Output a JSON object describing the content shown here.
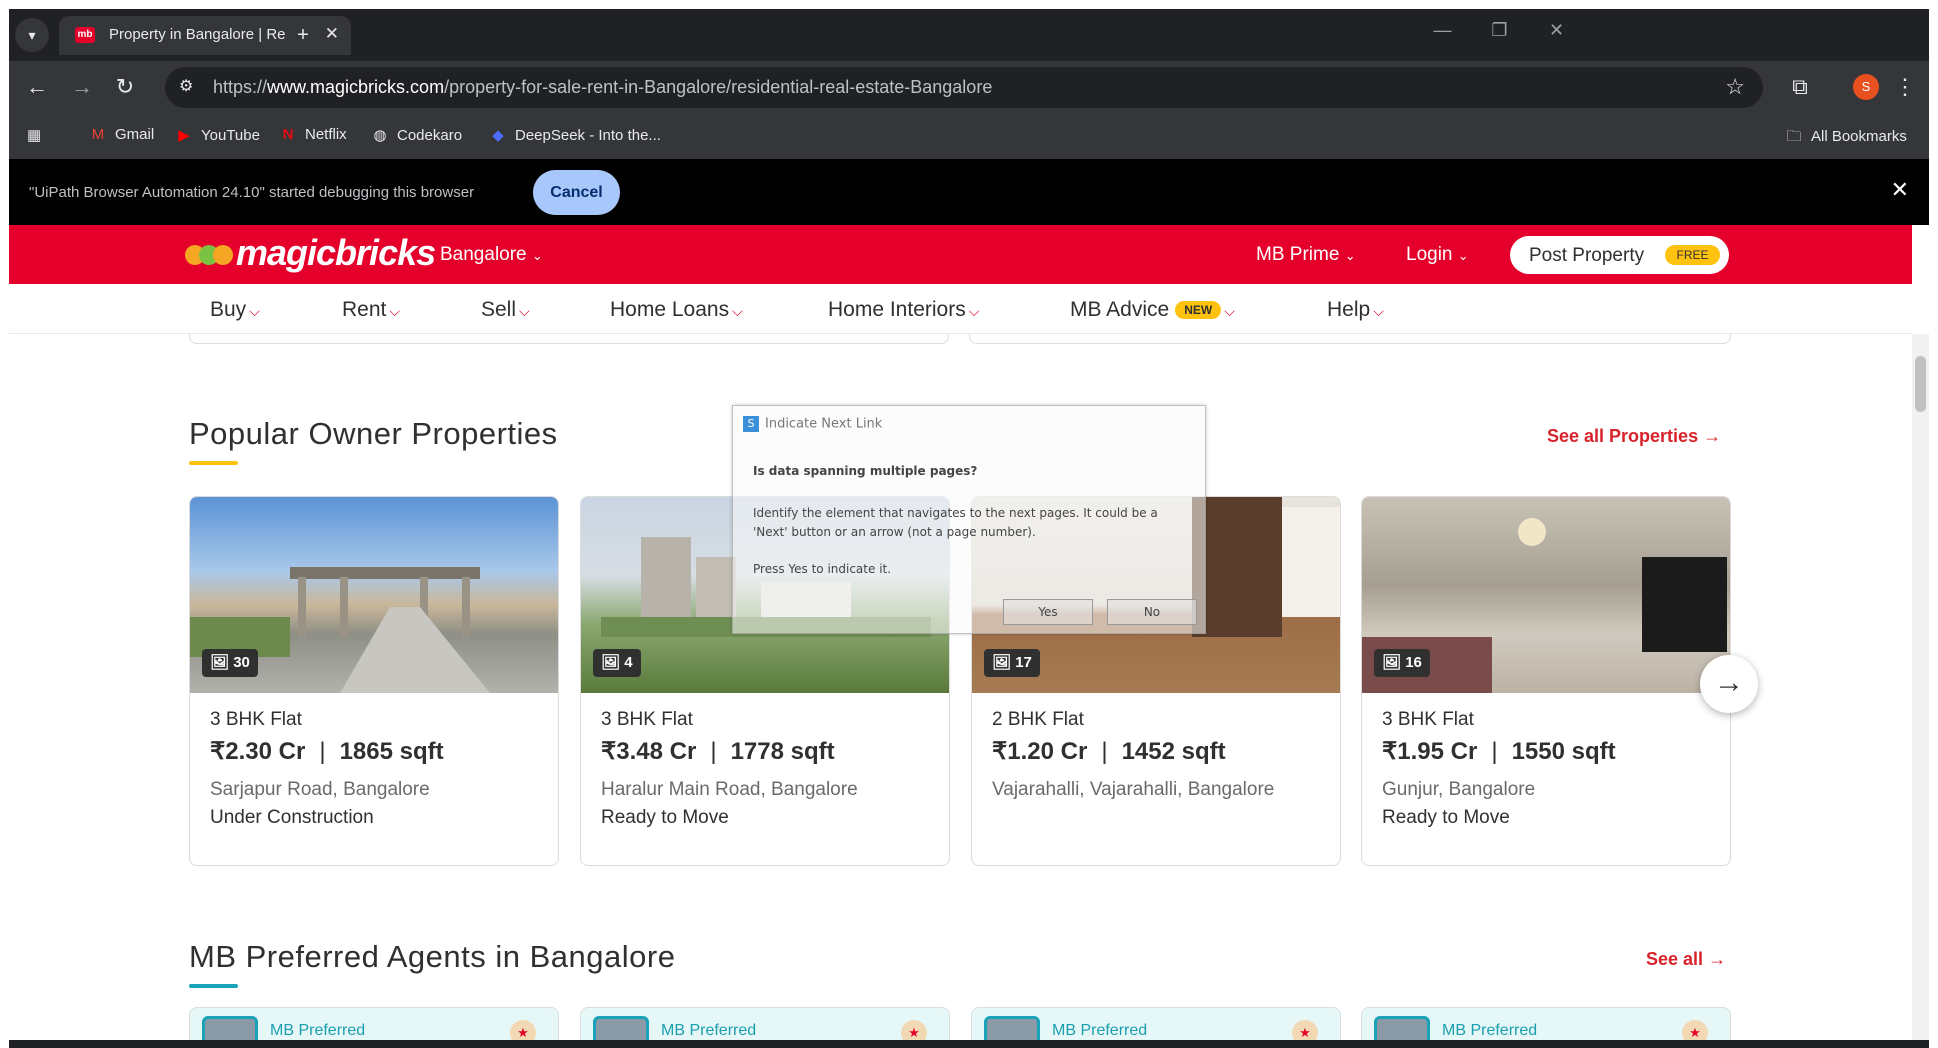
{
  "browser": {
    "tab_title": "Property in Bangalore | Real Est",
    "tab_favicon": "mb",
    "url_prefix": "https://",
    "url_domain": "www.magicbricks.com",
    "url_path": "/property-for-sale-rent-in-Bangalore/residential-real-estate-Bangalore",
    "profile_initial": "S",
    "bookmarks": [
      "Gmail",
      "YouTube",
      "Netflix",
      "Codekaro",
      "DeepSeek - Into the..."
    ],
    "all_bookmarks": "All Bookmarks"
  },
  "debug_bar": {
    "message": "\"UiPath Browser Automation 24.10\" started debugging this browser",
    "cancel_label": "Cancel"
  },
  "site_header": {
    "logo": "magicbricks",
    "city": "Bangalore",
    "mb_prime": "MB Prime",
    "login": "Login",
    "post_property": "Post Property",
    "free_badge": "FREE"
  },
  "sub_nav": {
    "items": [
      "Buy",
      "Rent",
      "Sell",
      "Home Loans",
      "Home Interiors",
      "MB Advice",
      "Help"
    ],
    "new_badge": "NEW"
  },
  "popular_section": {
    "title": "Popular Owner Properties",
    "see_all": "See all Properties",
    "cards": [
      {
        "photos": "30",
        "type": "3 BHK Flat",
        "price": "₹2.30 Cr",
        "area": "1865 sqft",
        "location": "Sarjapur Road, Bangalore",
        "status": "Under Construction"
      },
      {
        "photos": "4",
        "type": "3 BHK Flat",
        "price": "₹3.48 Cr",
        "area": "1778 sqft",
        "location": "Haralur Main Road, Bangalore",
        "status": "Ready to Move"
      },
      {
        "photos": "17",
        "type": "2 BHK Flat",
        "price": "₹1.20 Cr",
        "area": "1452 sqft",
        "location": "Vajarahalli, Vajarahalli, Bangalore",
        "status": ""
      },
      {
        "photos": "16",
        "type": "3 BHK Flat",
        "price": "₹1.95 Cr",
        "area": "1550 sqft",
        "location": "Gunjur, Bangalore",
        "status": "Ready to Move"
      }
    ]
  },
  "agents_section": {
    "title": "MB Preferred Agents in Bangalore",
    "see_all": "See all",
    "agent_label": "MB Preferred"
  },
  "dialog": {
    "title": "Indicate Next Link",
    "question": "Is data spanning multiple pages?",
    "body": "Identify the element that navigates to the next pages. It could be a 'Next' button or an arrow (not a page number).",
    "instruction": "Press Yes to indicate it.",
    "yes_label": "Yes",
    "no_label": "No"
  },
  "colors": {
    "brand_red": "#e4002b",
    "accent_yellow": "#ffc20e",
    "accent_teal": "#1aa3b8",
    "link_red": "#d8232a"
  }
}
